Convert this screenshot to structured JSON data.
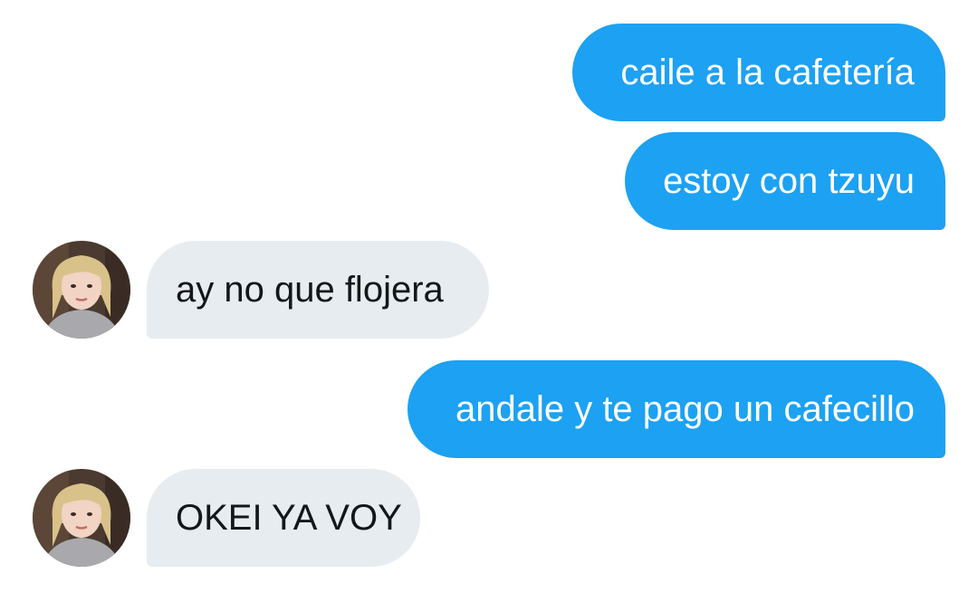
{
  "messages": [
    {
      "direction": "sent",
      "text": "caile a la cafetería"
    },
    {
      "direction": "sent",
      "text": "estoy con tzuyu"
    },
    {
      "direction": "received",
      "text": "ay no que flojera",
      "avatar_icon": "user-avatar-photo"
    },
    {
      "direction": "sent",
      "text": "andale y te pago un cafecillo"
    },
    {
      "direction": "received",
      "text": "OKEI YA VOY",
      "avatar_icon": "user-avatar-photo"
    }
  ],
  "colors": {
    "sent_bubble": "#1da1f2",
    "sent_text": "#ffffff",
    "received_bubble": "#e6ecf0",
    "received_text": "#14171a",
    "background": "#ffffff"
  }
}
